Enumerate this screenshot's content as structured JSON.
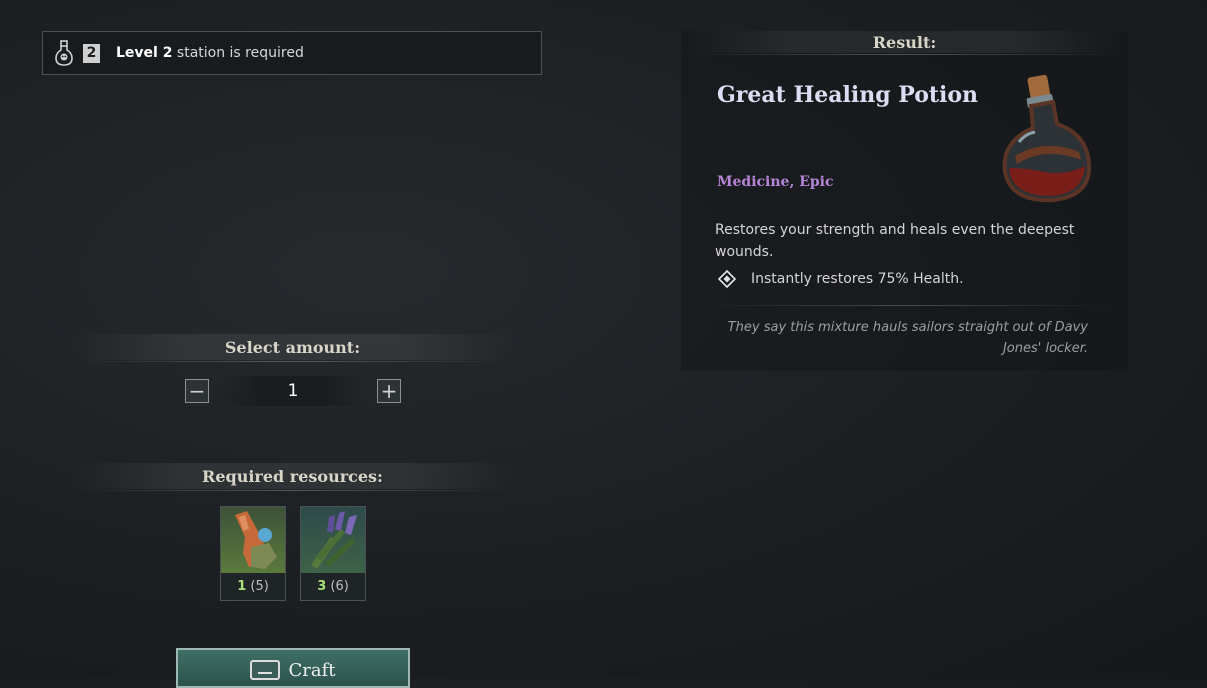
{
  "station": {
    "level_number": "2",
    "level_label": "Level 2",
    "text": "station is required"
  },
  "amount": {
    "header": "Select amount:",
    "value": "1",
    "minus_symbol": "−",
    "plus_symbol": "+"
  },
  "resources": {
    "header": "Required resources:",
    "items": [
      {
        "icon": "bandage-icon",
        "have": "1",
        "total": "(5)"
      },
      {
        "icon": "lavender-herb-icon",
        "have": "3",
        "total": "(6)"
      }
    ]
  },
  "craft": {
    "label": "Craft"
  },
  "result": {
    "header": "Result:",
    "title": "Great Healing Potion",
    "category": "Medicine, Epic",
    "description": "Restores your strength and heals even the deepest wounds.",
    "effect": "Instantly restores 75% Health.",
    "flavor": "They say this mixture hauls sailors straight out of Davy Jones' locker.",
    "icon": "potion-icon"
  },
  "colors": {
    "category": "#b785d8",
    "have_count": "#a8e07a",
    "craft_button": "#3f6f66",
    "title": "#dcdcf2"
  }
}
